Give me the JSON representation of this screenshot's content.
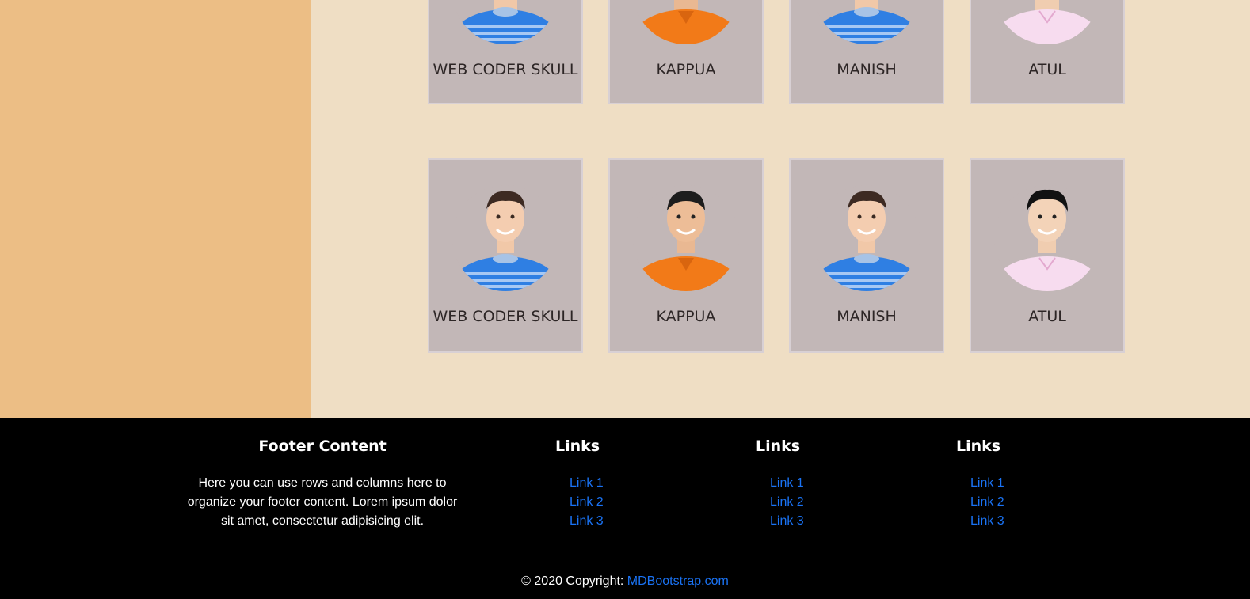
{
  "team_cards": [
    {
      "name": "WEB CODER SKULL",
      "avatar_icon": "person-striped-shirt-avatar"
    },
    {
      "name": "KAPPUA",
      "avatar_icon": "person-orange-shirt-avatar"
    },
    {
      "name": "MANISH",
      "avatar_icon": "person-striped-shirt-avatar"
    },
    {
      "name": "ATUL",
      "avatar_icon": "person-pink-shirt-avatar"
    },
    {
      "name": "WEB CODER SKULL",
      "avatar_icon": "person-striped-shirt-avatar"
    },
    {
      "name": "KAPPUA",
      "avatar_icon": "person-orange-shirt-avatar"
    },
    {
      "name": "MANISH",
      "avatar_icon": "person-striped-shirt-avatar"
    },
    {
      "name": "ATUL",
      "avatar_icon": "person-pink-shirt-avatar"
    }
  ],
  "footer": {
    "content_title": "Footer Content",
    "content_text": "Here you can use rows and columns here to organize your footer content. Lorem ipsum dolor sit amet, consectetur adipisicing elit.",
    "link_columns": [
      {
        "title": "Links",
        "links": [
          "Link 1",
          "Link 2",
          "Link 3"
        ]
      },
      {
        "title": "Links",
        "links": [
          "Link 1",
          "Link 2",
          "Link 3"
        ]
      },
      {
        "title": "Links",
        "links": [
          "Link 1",
          "Link 2",
          "Link 3"
        ]
      }
    ],
    "copyright_text": "© 2020 Copyright: ",
    "copyright_link": "MDBootstrap.com"
  },
  "colors": {
    "sidebar_bg": "#ecbe85",
    "content_bg": "#efdec4",
    "card_bg": "#c2b7b7",
    "footer_bg": "#000000",
    "link": "#1a73f5"
  }
}
